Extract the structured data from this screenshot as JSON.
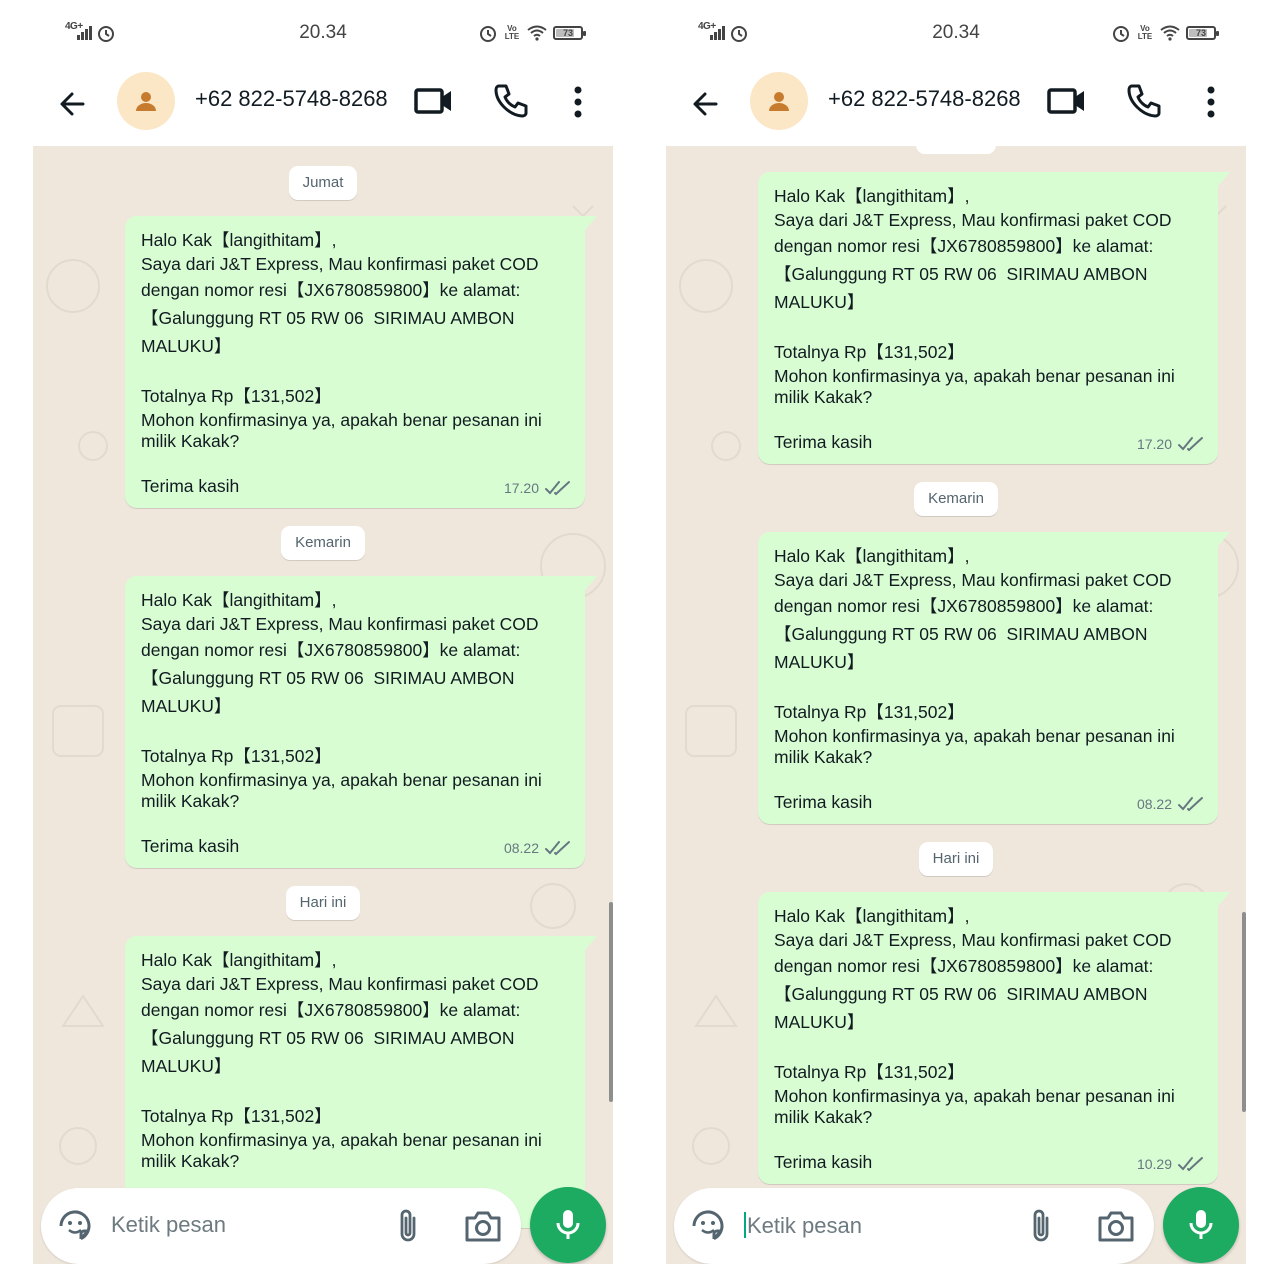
{
  "status_bar": {
    "network": "4G+",
    "time": "20.34",
    "lte": "Vo LTE",
    "battery": "73"
  },
  "header": {
    "contact": "+62 822-5748-8268"
  },
  "input": {
    "placeholder": "Ketik pesan"
  },
  "message": {
    "line1": "Halo Kak【langithitam】,",
    "line2": "Saya dari J&T Express, Mau konfirmasi paket COD",
    "line3": "dengan nomor resi【JX6780859800】ke alamat:",
    "line4": "【Galunggung RT 05 RW 06  SIRIMAU AMBON",
    "line5": "MALUKU】",
    "line6": "Totalnya Rp【131,502】",
    "line7": "Mohon konfirmasinya ya, apakah benar pesanan ini",
    "line8": "milik Kakak?",
    "line9": "Terima kasih"
  },
  "left_screen": {
    "dates": [
      "Jumat",
      "Kemarin",
      "Hari ini"
    ],
    "times": [
      "17.20",
      "08.22"
    ]
  },
  "right_screen": {
    "dates": [
      "Kemarin",
      "Hari ini"
    ],
    "times": [
      "17.20",
      "08.22",
      "10.29"
    ]
  },
  "colors": {
    "bubble": "#d9fdd3",
    "chat_bg": "#efe7dc",
    "mic_button": "#1daa61",
    "read_ticks": "#667781"
  },
  "icons": [
    "back-arrow-icon",
    "person-icon",
    "video-call-icon",
    "phone-icon",
    "more-vert-icon",
    "sticker-icon",
    "attach-icon",
    "camera-icon",
    "mic-icon",
    "double-check-icon",
    "alarm-icon",
    "wifi-icon",
    "battery-icon"
  ]
}
